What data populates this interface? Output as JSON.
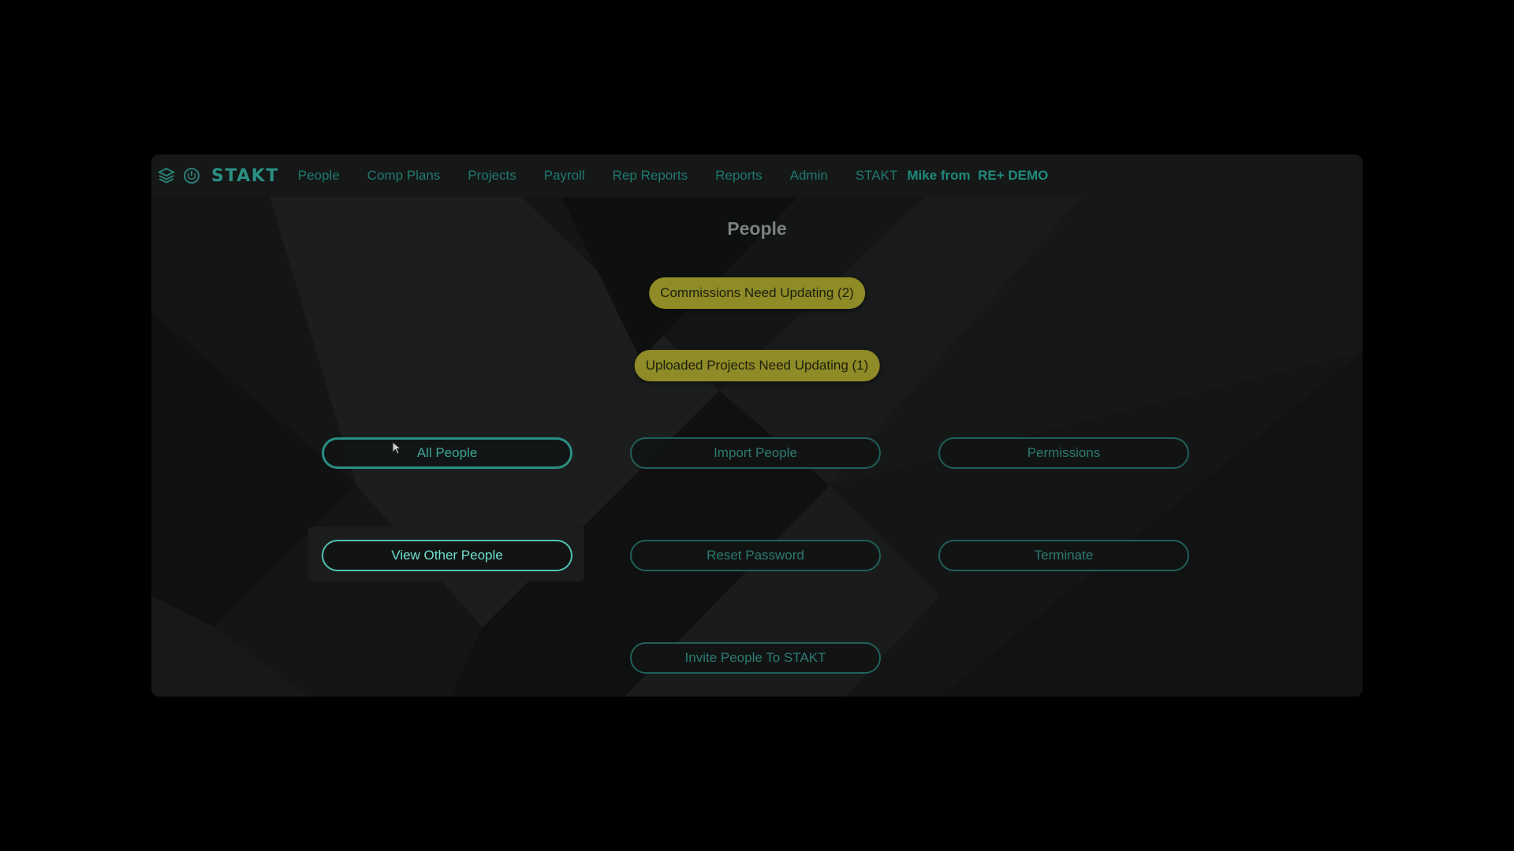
{
  "nav": {
    "brand": "STAKT",
    "icons": [
      "layers-icon",
      "power-icon"
    ],
    "links": [
      "People",
      "Comp Plans",
      "Projects",
      "Payroll",
      "Rep Reports",
      "Reports",
      "Admin",
      "STAKT"
    ],
    "user": "Mike from  RE+ DEMO"
  },
  "page": {
    "title": "People"
  },
  "alerts": {
    "commissions": "Commissions Need Updating (2)",
    "uploaded_projects": "Uploaded Projects Need Updating (1)"
  },
  "actions": {
    "all_people": "All People",
    "import_people": "Import People",
    "permissions": "Permissions",
    "view_other_people": "View Other People",
    "reset_password": "Reset Password",
    "terminate": "Terminate",
    "invite_people": "Invite People To STAKT"
  },
  "colors": {
    "accent": "#2a8f83",
    "alert": "#8f8b26",
    "background": "#000000"
  }
}
